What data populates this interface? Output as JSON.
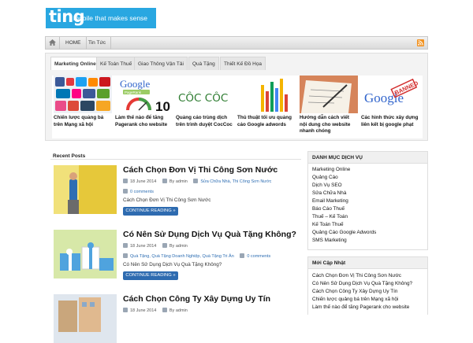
{
  "header": {
    "logo": "ting",
    "tagline": "mobile that makes sense"
  },
  "nav": {
    "items": [
      "HOME",
      "Tin Tức"
    ]
  },
  "featured": {
    "tabs": [
      "Marketing Online",
      "Kế Toán Thuế",
      "Giao Thông Vận Tải",
      "Quà Tặng",
      "Thiết Kế Đồ Họa"
    ],
    "items": [
      {
        "caption": "Chiến lược quảng bá trên Mạng xã hội"
      },
      {
        "caption": "Làm thế nào để tăng Pagerank cho website",
        "image_text": "Google",
        "image_badge": "PageRank",
        "image_number": "10"
      },
      {
        "caption": "Quảng cáo trùng dịch trên trình duyệt CocCoc",
        "image_text": "CÔC CÔC"
      },
      {
        "caption": "Thủ thuật tối ưu quảng cáo Google adwords"
      },
      {
        "caption": "Hướng dẫn cách viết nội dung cho website nhanh chóng"
      },
      {
        "caption": "Các hình thức xây dựng liên kết bị google phạt",
        "image_text": "Google",
        "image_stamp": "BANNED"
      }
    ]
  },
  "recent": {
    "heading": "Recent Posts",
    "posts": [
      {
        "title": "Cách Chọn Đơn Vị Thi Công Sơn Nước",
        "date": "18 June 2014",
        "author": "By admin",
        "categories": "Sửa Chữa Nhà, Thi Công Sơn Nước",
        "comments": "0 comments",
        "excerpt": "Cách Chọn Đơn Vị Thi Công Sơn Nước",
        "more": "CONTINUE READING »"
      },
      {
        "title": "Có Nên Sử Dụng Dịch Vụ Quà Tặng Không?",
        "date": "18 June 2014",
        "author": "By admin",
        "categories": "Quà Tặng, Quà Tặng Doanh Nghiệp, Quà Tặng Tri Ân",
        "comments": "0 comments",
        "excerpt": "Có Nên Sử Dụng Dịch Vụ Quà Tặng Không?",
        "more": "CONTINUE READING »"
      },
      {
        "title": "Cách Chọn Công Ty Xây Dựng Uy Tín",
        "date": "18 June 2014",
        "author": "By admin"
      }
    ]
  },
  "sidebar": {
    "services": {
      "heading": "DANH MỤC DỊCH VỤ",
      "links": [
        "Marketing Online",
        "Quảng Cáo",
        "Dịch Vụ SEO",
        "Sửa Chữa Nhà",
        "Email Marketing",
        "Báo Cáo Thuế",
        "Thuế – Kế Toán",
        "Kế Toán Thuế",
        "Quảng Cáo Google Adwords",
        "SMS Marketing"
      ]
    },
    "updates": {
      "heading": "Mới Cập Nhật",
      "links": [
        "Cách Chọn Đơn Vị Thi Công Sơn Nước",
        "Có Nên Sử Dụng Dịch Vụ Quà Tặng Không?",
        "Cách Chọn Công Ty Xây Dựng Uy Tín",
        "Chiến lược quảng bá trên Mạng xã hội",
        "Làm thế nào để tăng Pagerank cho website"
      ]
    }
  },
  "colors": {
    "logo": "#29a7e1",
    "button": "#2e6bb0",
    "link": "#2e6eb3",
    "rss": "#f29322"
  }
}
